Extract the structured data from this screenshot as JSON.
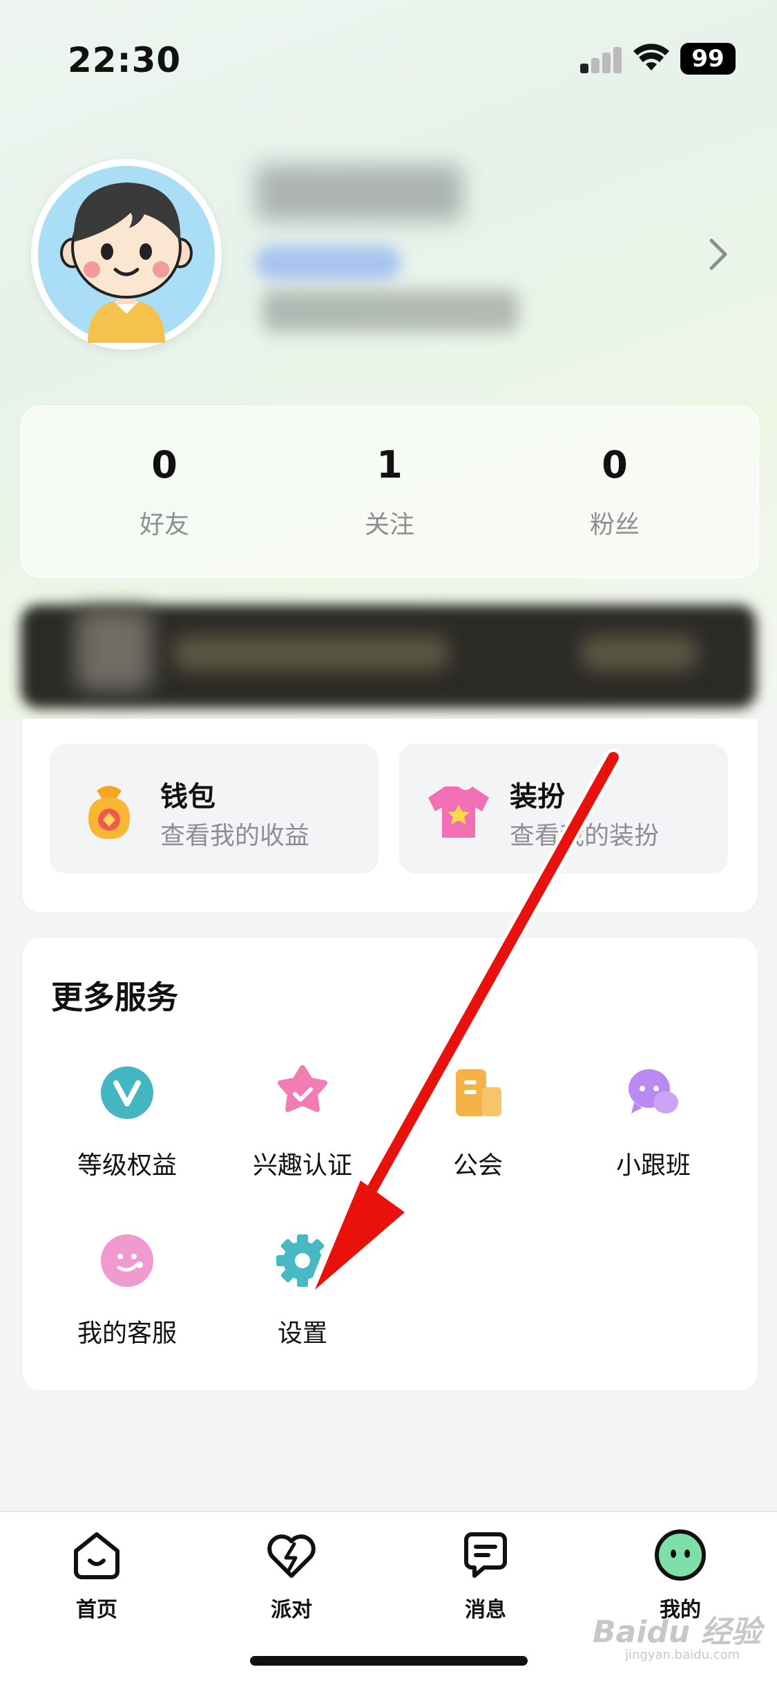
{
  "status_bar": {
    "time": "22:30",
    "battery": "99"
  },
  "stats": [
    {
      "value": "0",
      "label": "好友"
    },
    {
      "value": "1",
      "label": "关注"
    },
    {
      "value": "0",
      "label": "粉丝"
    }
  ],
  "quick_tiles": {
    "wallet": {
      "title": "钱包",
      "subtitle": "查看我的收益"
    },
    "dressup": {
      "title": "装扮",
      "subtitle": "查看我的装扮"
    }
  },
  "more_services": {
    "title": "更多服务",
    "items": [
      {
        "label": "等级权益",
        "icon": "vip-level-icon"
      },
      {
        "label": "兴趣认证",
        "icon": "interest-cert-icon"
      },
      {
        "label": "公会",
        "icon": "guild-icon"
      },
      {
        "label": "小跟班",
        "icon": "chat-bubbles-icon"
      },
      {
        "label": "我的客服",
        "icon": "customer-service-icon"
      },
      {
        "label": "设置",
        "icon": "gear-icon"
      }
    ]
  },
  "tabbar": {
    "items": [
      {
        "label": "首页",
        "icon": "home-icon"
      },
      {
        "label": "派对",
        "icon": "party-heart-icon"
      },
      {
        "label": "消息",
        "icon": "message-icon"
      },
      {
        "label": "我的",
        "icon": "me-icon"
      }
    ],
    "active": "我的"
  },
  "watermark": {
    "brand": "Baidu 经验",
    "site": "jingyan.baidu.com"
  },
  "colors": {
    "accent_green": "#7ee0a8",
    "arrow_red": "#e8110c",
    "vip_teal": "#43b6c2",
    "interest_pink": "#f27cb4",
    "guild_orange": "#f5b347",
    "chat_purple": "#b98af2",
    "service_pink": "#f09ad0",
    "gear_teal": "#47b8c4"
  }
}
